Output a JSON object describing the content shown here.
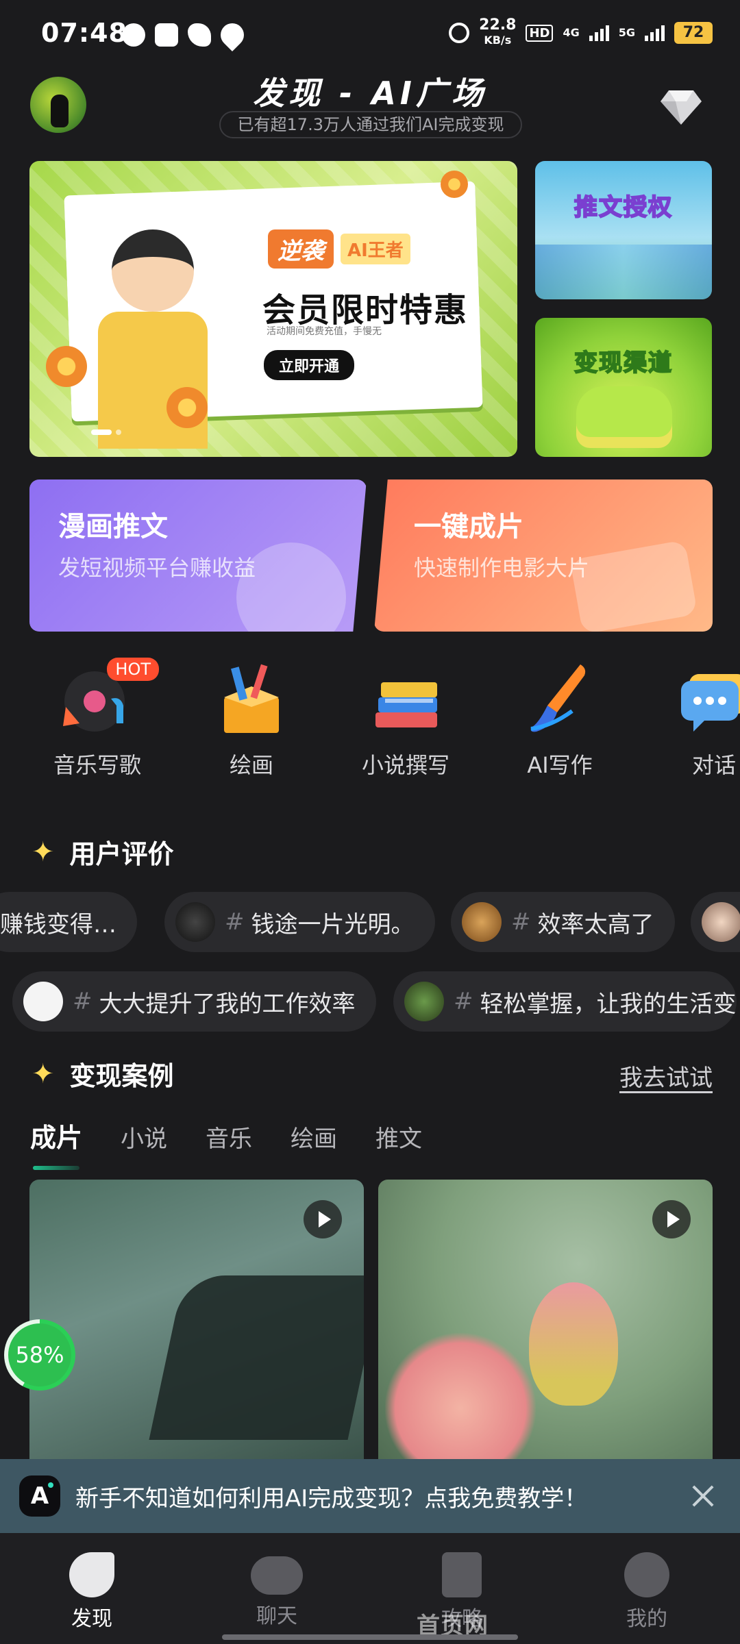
{
  "status_bar": {
    "time": "07:48",
    "speed_value": "22.8",
    "speed_unit": "KB/s",
    "hd_label": "HD",
    "net_4g": "4G",
    "net_5g": "5G",
    "battery": "72",
    "icons": [
      "vpn-icon",
      "shield-v-icon",
      "bird-icon",
      "heart-check-icon",
      "alarm-icon"
    ]
  },
  "header": {
    "title": "发现 - AI广场",
    "subtitle": "已有超17.3万人通过我们AI完成变现",
    "avatar_icon": "penguin-avatar",
    "vip_icon": "diamond-icon"
  },
  "banner_main": {
    "badge_left": "逆袭",
    "badge_right": "AI王者",
    "headline": "会员限时特惠",
    "small_text": "活动期间免费充值，手慢无",
    "cta": "立即开通"
  },
  "banner_side": {
    "top_label": "推文授权",
    "bottom_label": "变现渠道"
  },
  "feature_cards": [
    {
      "title": "漫画推文",
      "subtitle": "发短视频平台赚收益"
    },
    {
      "title": "一键成片",
      "subtitle": "快速制作电影大片"
    }
  ],
  "tools": [
    {
      "label": "音乐写歌",
      "icon": "music-record-icon",
      "badge": "HOT"
    },
    {
      "label": "绘画",
      "icon": "paint-box-icon"
    },
    {
      "label": "小说撰写",
      "icon": "books-icon"
    },
    {
      "label": "AI写作",
      "icon": "brush-icon"
    },
    {
      "label": "对话",
      "icon": "chat-bubble-icon"
    }
  ],
  "reviews": {
    "title": "用户评价",
    "row1": [
      "赚钱变得…",
      "钱途一片光明。",
      "效率太高了",
      ""
    ],
    "row2": [
      "大大提升了我的工作效率",
      "轻松掌握，让我的生活变"
    ],
    "hash": "#"
  },
  "cases": {
    "title": "变现案例",
    "try_link": "我去试试",
    "tabs": [
      "成片",
      "小说",
      "音乐",
      "绘画",
      "推文"
    ],
    "active_tab": 0
  },
  "progress_badge": {
    "value": "58%",
    "fraction": 0.58
  },
  "tip_bar": {
    "text": "新手不知道如何利用AI完成变现？点我免费教学！"
  },
  "bottom_nav": [
    {
      "label": "发现",
      "icon": "leaf-icon",
      "active": true
    },
    {
      "label": "聊天",
      "icon": "chat-robot-icon"
    },
    {
      "label": "攻略",
      "icon": "bookmark-star-icon"
    },
    {
      "label": "我的",
      "icon": "profile-face-icon"
    }
  ],
  "watermark": "首页网 www.shouma.com",
  "colors": {
    "background": "#1b1b1d",
    "accent_green": "#1fbf8c",
    "hot_red": "#ff4d2e",
    "tip_bar": "#3e5763"
  }
}
